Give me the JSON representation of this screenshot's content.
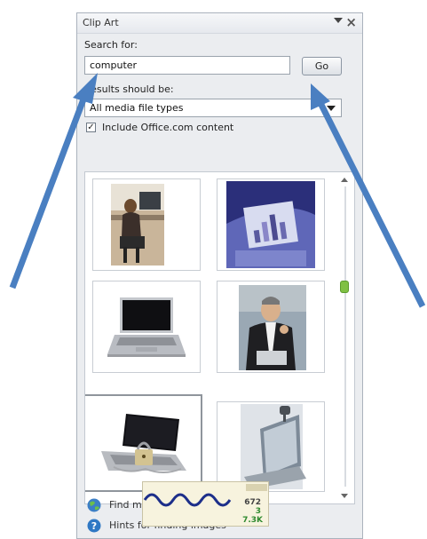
{
  "pane": {
    "title": "Clip Art",
    "search_label": "Search for:",
    "search_value": "computer",
    "go_label": "Go",
    "results_label": "Results should be:",
    "media_type_value": "All media file types",
    "include_label": "Include Office.com content",
    "include_checked": true
  },
  "results": {
    "items": [
      {
        "icon": "woman-at-desk-photo"
      },
      {
        "icon": "monitor-bar-chart-photo"
      },
      {
        "icon": "open-laptop-photo"
      },
      {
        "icon": "businessman-with-laptop-photo"
      },
      {
        "icon": "padlocked-laptop-photo"
      },
      {
        "icon": "laptop-with-webcam-photo"
      }
    ]
  },
  "footer": {
    "find_more_label": "Find more at Office.com",
    "hints_label": "Hints for finding images"
  },
  "gadget": {
    "stat1": "672",
    "stat2": "3",
    "stat3": "7.3K"
  },
  "colors": {
    "annotation_arrow": "#4a7fc1",
    "scroll_thumb": "#7fc043"
  }
}
